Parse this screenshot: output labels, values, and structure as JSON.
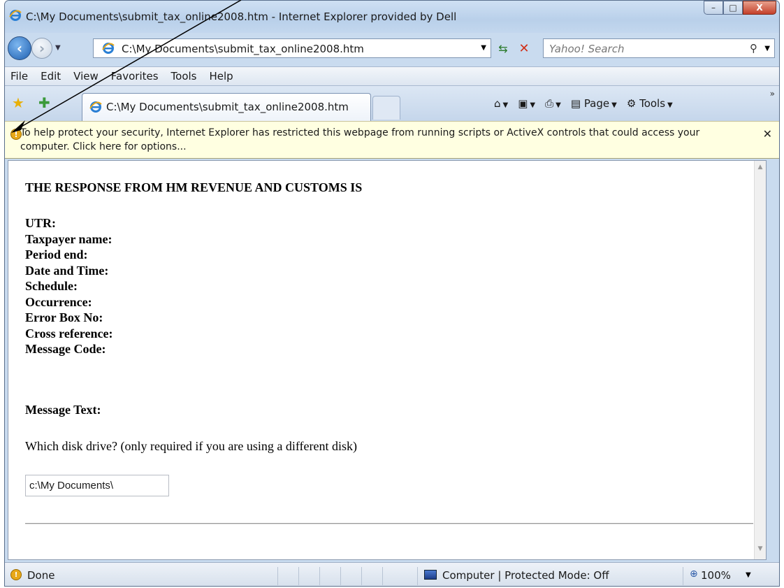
{
  "window": {
    "title": "C:\\My Documents\\submit_tax_online2008.htm - Internet Explorer provided by Dell",
    "minimize": "–",
    "maximize": "□",
    "close": "X"
  },
  "address": {
    "url": "C:\\My Documents\\submit_tax_online2008.htm",
    "search_placeholder": "Yahoo! Search"
  },
  "menu": [
    "File",
    "Edit",
    "View",
    "Favorites",
    "Tools",
    "Help"
  ],
  "tab": {
    "title": "C:\\My Documents\\submit_tax_online2008.htm"
  },
  "commands": {
    "page": "Page",
    "tools": "Tools"
  },
  "infobar": {
    "text": "To help protect your security, Internet Explorer has restricted this webpage from running scripts or ActiveX controls that could access your computer. Click here for options..."
  },
  "page": {
    "heading": "THE RESPONSE FROM HM REVENUE AND CUSTOMS IS",
    "fields": [
      "UTR:",
      "Taxpayer name:",
      "Period end:",
      "Date and Time:",
      "Schedule:",
      "Occurrence:",
      "Error Box No:",
      "Cross reference:",
      "Message Code:"
    ],
    "message_text_label": "Message Text:",
    "disk_question": "Which disk drive? (only required if you are using a different disk)",
    "disk_value": "c:\\My Documents\\"
  },
  "status": {
    "text": "Done",
    "zone": "Computer | Protected Mode: Off",
    "zoom": "100%"
  },
  "icons": {
    "ie": "ie-logo-icon",
    "warning": "security-warning-icon",
    "accent": "#1e5fb0",
    "infobar_bg": "#ffffe1"
  }
}
